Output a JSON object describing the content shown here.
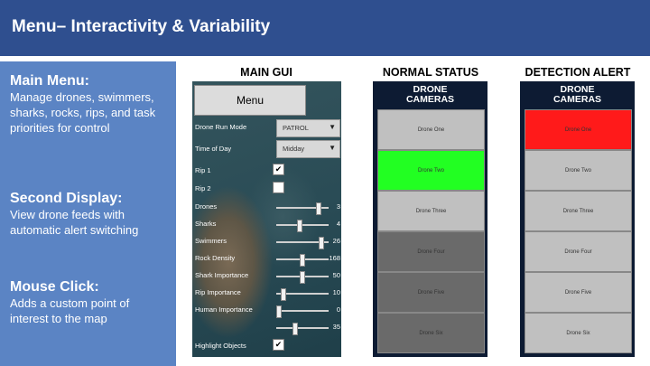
{
  "header": {
    "title": "Menu– Interactivity & Variability"
  },
  "left": {
    "sections": [
      {
        "title": "Main Menu:",
        "body": "Manage drones, swimmers, sharks, rocks, rips, and task priorities for control"
      },
      {
        "title": "Second Display:",
        "body": "View drone feeds with automatic alert switching"
      },
      {
        "title": "Mouse Click:",
        "body": "Adds a custom point of interest to the map"
      }
    ]
  },
  "columns": {
    "main_gui": "MAIN GUI",
    "normal_status": "NORMAL STATUS",
    "detection_alert": "DETECTION ALERT"
  },
  "gui": {
    "menu_label": "Menu",
    "drone_run_mode": {
      "label": "Drone Run Mode",
      "value": "PATROL"
    },
    "time_of_day": {
      "label": "Time of Day",
      "value": "Midday"
    },
    "rip1": {
      "label": "Rip 1",
      "checked": true,
      "mark": "✔"
    },
    "rip2": {
      "label": "Rip 2",
      "checked": false,
      "mark": ""
    },
    "sliders": [
      {
        "label": "Drones",
        "value": "3",
        "fraction": 0.85
      },
      {
        "label": "Sharks",
        "value": "4",
        "fraction": 0.45
      },
      {
        "label": "Swimmers",
        "value": "26",
        "fraction": 0.9
      },
      {
        "label": "Rock Density",
        "value": "168",
        "fraction": 0.5
      },
      {
        "label": "Shark Importance",
        "value": "50",
        "fraction": 0.5
      },
      {
        "label": "Rip Importance",
        "value": "10",
        "fraction": 0.1
      },
      {
        "label": "Human Importance",
        "value": "0",
        "fraction": 0.0
      },
      {
        "label": "",
        "value": "35",
        "fraction": 0.35
      }
    ],
    "highlight": {
      "label": "Highlight Objects",
      "checked": true,
      "mark": "✔"
    }
  },
  "normal_panel": {
    "title_line1": "DRONE",
    "title_line2": "CAMERAS",
    "cameras": [
      {
        "label": "Drone One",
        "color": "#c0c0c0"
      },
      {
        "label": "Drone Two",
        "color": "#22ff22"
      },
      {
        "label": "Drone Three",
        "color": "#c0c0c0"
      },
      {
        "label": "Drone Four",
        "color": "#6a6a6a"
      },
      {
        "label": "Drone Five",
        "color": "#6a6a6a"
      },
      {
        "label": "Drone Six",
        "color": "#6a6a6a"
      }
    ]
  },
  "alert_panel": {
    "title_line1": "DRONE",
    "title_line2": "CAMERAS",
    "cameras": [
      {
        "label": "Drone One",
        "color": "#ff1a1a"
      },
      {
        "label": "Drone Two",
        "color": "#c0c0c0"
      },
      {
        "label": "Drone Three",
        "color": "#c0c0c0"
      },
      {
        "label": "Drone Four",
        "color": "#c0c0c0"
      },
      {
        "label": "Drone Five",
        "color": "#c0c0c0"
      },
      {
        "label": "Drone Six",
        "color": "#c0c0c0"
      }
    ]
  }
}
